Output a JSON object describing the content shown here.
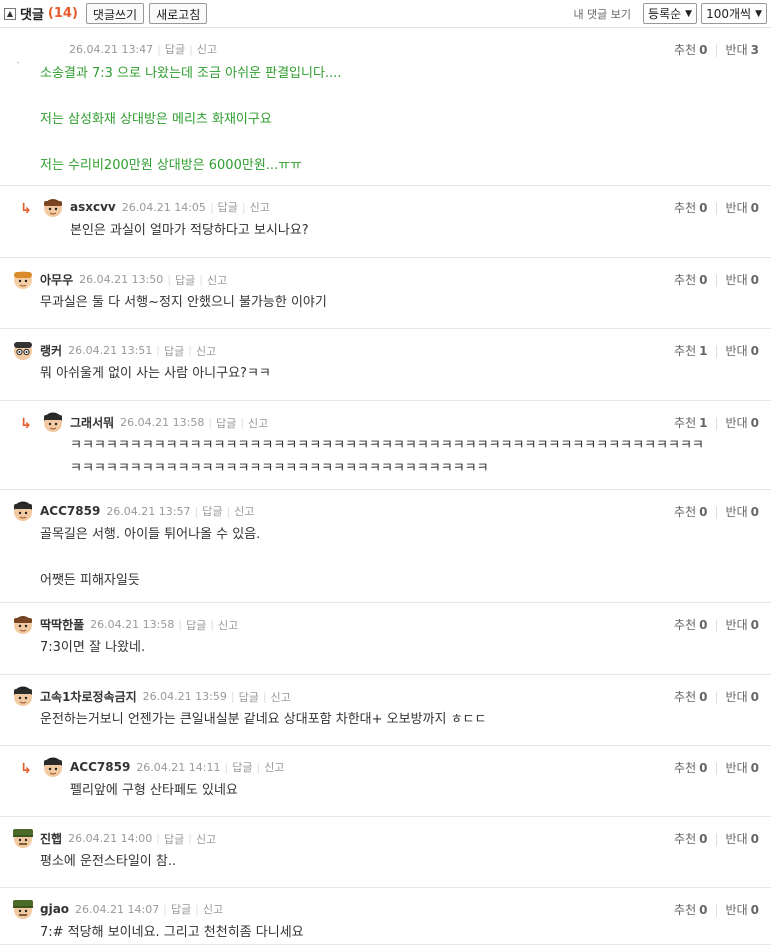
{
  "header": {
    "title": "댓글",
    "count": "(14)",
    "write_btn": "댓글쓰기",
    "refresh_btn": "새로고침",
    "my_comments": "내 댓글 보기",
    "sort_value": "등록순",
    "per_page_value": "100개씩"
  },
  "labels": {
    "reply": "답글",
    "report": "신고",
    "up": "추천",
    "down": "반대"
  },
  "comments": [
    {
      "nick": "",
      "date": "26.04.21 13:47",
      "up": "0",
      "down": "3",
      "lines": [
        "소송결과 7:3 으로 나왔는데 조금 아쉬운 판결입니다....",
        "",
        "저는 삼성화재 상대방은 메리츠 화재이구요",
        "",
        "저는 수리비200만원 상대방은 6000만원...ㅠㅠ"
      ]
    },
    {
      "nick": "asxcvv",
      "date": "26.04.21 14:05",
      "up": "0",
      "down": "0",
      "lines": [
        "본인은 과실이 얼마가 적당하다고 보시나요?"
      ]
    },
    {
      "nick": "아무우",
      "date": "26.04.21 13:50",
      "up": "0",
      "down": "0",
      "lines": [
        "무과실은 둘 다 서행~정지 안했으니 불가능한 이야기"
      ]
    },
    {
      "nick": "랭커",
      "date": "26.04.21 13:51",
      "up": "1",
      "down": "0",
      "lines": [
        "뭐 아쉬울게 없이 사는 사람 아니구요?ㅋㅋ"
      ]
    },
    {
      "nick": "그래서뭐",
      "date": "26.04.21 13:58",
      "up": "1",
      "down": "0",
      "lines": [
        "ㅋㅋㅋㅋㅋㅋㅋㅋㅋㅋㅋㅋㅋㅋㅋㅋㅋㅋㅋㅋㅋㅋㅋㅋㅋㅋㅋㅋㅋㅋㅋㅋㅋㅋㅋㅋㅋㅋㅋㅋㅋㅋㅋㅋㅋㅋㅋㅋㅋㅋㅋㅋㅋ",
        "ㅋㅋㅋㅋㅋㅋㅋㅋㅋㅋㅋㅋㅋㅋㅋㅋㅋㅋㅋㅋㅋㅋㅋㅋㅋㅋㅋㅋㅋㅋㅋㅋㅋㅋㅋ"
      ]
    },
    {
      "nick": "ACC7859",
      "date": "26.04.21 13:57",
      "up": "0",
      "down": "0",
      "lines": [
        "골목길은 서행. 아이들 튀어나올 수 있음.",
        "",
        "어쨋든 피해자일듯"
      ]
    },
    {
      "nick": "딱딱한풀",
      "date": "26.04.21 13:58",
      "up": "0",
      "down": "0",
      "lines": [
        "7:3이면 잘 나왔네."
      ]
    },
    {
      "nick": "고속1차로정속금지",
      "date": "26.04.21 13:59",
      "up": "0",
      "down": "0",
      "lines": [
        "운전하는거보니 언젠가는 큰일내실분 같네요 상대포함 차한대+ 오보방까지 ㅎㄷㄷ"
      ]
    },
    {
      "nick": "ACC7859",
      "date": "26.04.21 14:11",
      "up": "0",
      "down": "0",
      "lines": [
        "펠리앞에 구형 산타페도 있네요"
      ]
    },
    {
      "nick": "진햅",
      "date": "26.04.21 14:00",
      "up": "0",
      "down": "0",
      "lines": [
        "평소에 운전스타일이 참.."
      ]
    },
    {
      "nick": "gjao",
      "date": "26.04.21 14:07",
      "up": "0",
      "down": "0",
      "lines": [
        "7:# 적당해 보이네요. 그리고 천천히좀 다니세요"
      ]
    }
  ]
}
